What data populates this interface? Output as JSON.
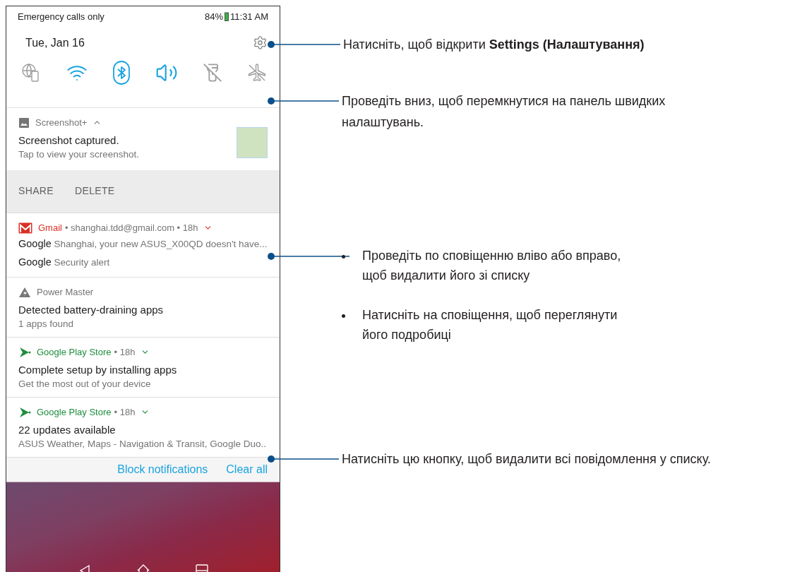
{
  "status_bar": {
    "carrier": "Emergency calls only",
    "battery": "84%",
    "time": "11:31 AM"
  },
  "header": {
    "date": "Tue, Jan 16"
  },
  "quick_settings": [
    {
      "kind": "globe-phone",
      "on": false
    },
    {
      "kind": "wifi",
      "on": true
    },
    {
      "kind": "bluetooth",
      "on": true
    },
    {
      "kind": "sound",
      "on": true
    },
    {
      "kind": "flashlight",
      "on": false
    },
    {
      "kind": "airplane",
      "on": false
    }
  ],
  "notifications": [
    {
      "kind": "screenshot",
      "app": "Screenshot+",
      "expanded": true,
      "title": "Screenshot captured.",
      "text": "Tap to view your screenshot.",
      "actions": [
        "SHARE",
        "DELETE"
      ]
    },
    {
      "kind": "gmail",
      "app": "Gmail",
      "color": "#d93025",
      "meta": "• shanghai.tdd@gmail.com • 18h",
      "expanded": false,
      "lines": [
        {
          "sender": "Google",
          "text": "Shanghai, your new ASUS_X00QD doesn't have..."
        },
        {
          "sender": "Google",
          "text": "Security alert"
        }
      ]
    },
    {
      "kind": "power",
      "app": "Power Master",
      "color": "#757575",
      "title": "Detected battery-draining apps",
      "text": "1 apps found"
    },
    {
      "kind": "play",
      "app": "Google Play Store",
      "color": "#1e8e3e",
      "meta": "• 18h",
      "expanded": false,
      "title": "Complete setup by installing apps",
      "text": "Get the most out of your device"
    },
    {
      "kind": "play",
      "app": "Google Play Store",
      "color": "#1e8e3e",
      "meta": "• 18h",
      "expanded": false,
      "title": "22 updates available",
      "text": "ASUS Weather, Maps - Navigation & Transit, Google Duo.."
    }
  ],
  "footer": {
    "buttons": [
      "Block notifications",
      "Clear all"
    ]
  },
  "callouts": [
    {
      "kind": "text",
      "text": "Натисніть, щоб відкрити **Settings (Налаштування)**"
    },
    {
      "kind": "text",
      "text": "Проведіть вниз, щоб перемкнутися на панель швидких налаштувань."
    },
    {
      "kind": "bullets",
      "items": [
        "Проведіть по сповіщенню вліво або вправо, щоб видалити його зі списку",
        "Натисніть на сповіщення, щоб переглянути його подробиці"
      ]
    },
    {
      "kind": "text",
      "text": "Натисніть цю кнопку, щоб видалити всі повідомлення у списку."
    }
  ]
}
